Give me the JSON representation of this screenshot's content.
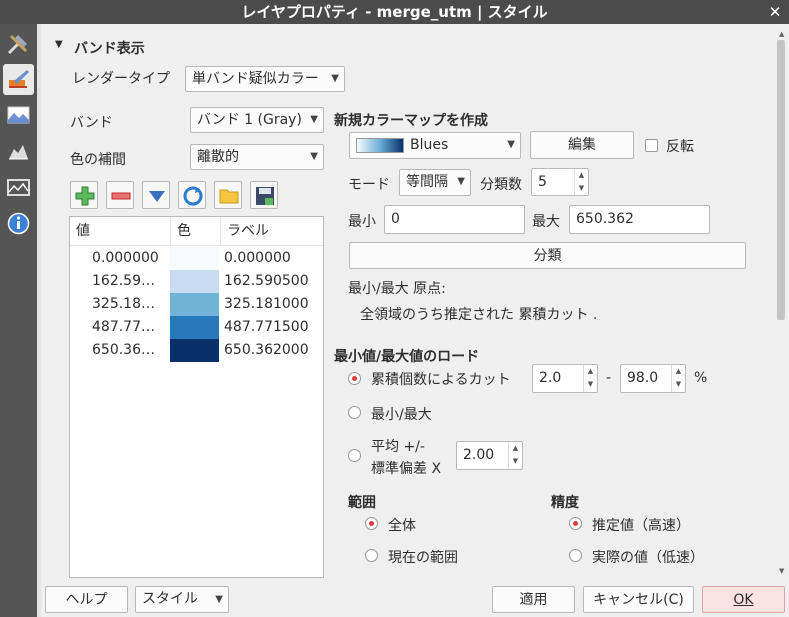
{
  "window": {
    "title": "レイヤプロパティ - merge_utm | スタイル"
  },
  "sidebar": {
    "icons": [
      "tools-icon",
      "paintbrush-icon",
      "transparency-icon",
      "histogram-icon",
      "pyramids-icon",
      "metadata-icon"
    ]
  },
  "band_section": {
    "title": "バンド表示"
  },
  "render_type": {
    "label": "レンダータイプ",
    "value": "単バンド疑似カラー"
  },
  "band": {
    "label": "バンド",
    "value": "バンド 1 (Gray)"
  },
  "interpolation": {
    "label": "色の補間",
    "value": "離散的"
  },
  "table": {
    "headers": [
      "値",
      "色",
      "ラベル"
    ],
    "rows": [
      {
        "value": "0.000000",
        "color": "#f7fbff",
        "label": "0.000000"
      },
      {
        "value": "162.59…",
        "color": "#c8dcf0",
        "label": "162.590500"
      },
      {
        "value": "325.18…",
        "color": "#73b2d8",
        "label": "325.181000"
      },
      {
        "value": "487.77…",
        "color": "#2879b9",
        "label": "487.771500"
      },
      {
        "value": "650.36…",
        "color": "#08306b",
        "label": "650.362000"
      }
    ]
  },
  "new_colormap": {
    "title": "新規カラーマップを作成",
    "ramp": "Blues",
    "edit_button": "編集",
    "invert_label": "反転",
    "mode_label": "モード",
    "mode_value": "等間隔",
    "classes_label": "分類数",
    "classes_value": "5",
    "min_label": "最小",
    "min_value": "0",
    "max_label": "最大",
    "max_value": "650.362",
    "classify_button": "分類",
    "origin_label": "最小/最大 原点:",
    "origin_value": "全領域のうち推定された 累積カット ."
  },
  "minmax_load": {
    "title": "最小値/最大値のロード",
    "cut_label": "累積個数によるカット",
    "cut_low": "2.0",
    "cut_sep": "-",
    "cut_high": "98.0",
    "cut_unit": "%",
    "minmax_label": "最小/最大",
    "stddev_label_1": "平均 +/-",
    "stddev_label_2": "標準偏差 X",
    "stddev_value": "2.00"
  },
  "extent": {
    "title": "範囲",
    "whole": "全体",
    "current": "現在の範囲"
  },
  "accuracy": {
    "title": "精度",
    "estimate": "推定値（高速）",
    "actual": "実際の値（低速）"
  },
  "footer": {
    "help": "ヘルプ",
    "style": "スタイル",
    "apply": "適用",
    "cancel": "キャンセル(C)",
    "ok": "OK"
  },
  "colors": {
    "ok_bg": "#fbe3e3",
    "radio_dot": "#e53935",
    "title_bar": "#4b4b4b",
    "sidebar": "#555555"
  }
}
